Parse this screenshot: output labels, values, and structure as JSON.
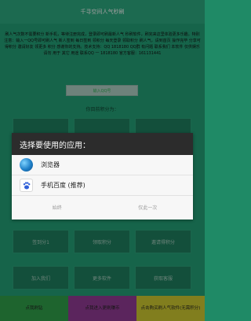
{
  "app": {
    "title": "千寻空间人气秒刷",
    "notice": "刷人气次数不需要积分 新手机，等待注册完成，登录即可刷最新人气 秒刷软件，刷完来这里体验更多乐趣。特别注意：输入一QQ号即可刷人气 新人签到 每日签到 领积分 每天登录 领取积分 刷人气，请到首页 操作完毕 分享可得积分 邀请好友 领更多 积分 感谢你的支持。技术支持：QQ 1818180 QQ群 有问题 联系我们 本软件 仅供娱乐 请勿 用于 其它 用途 联系QQ 一 1818180 官方客服：161131441",
    "input_placeholder": "输入QQ号",
    "points_label": "你目前积分为：",
    "grid_row1": [
      "",
      "",
      ""
    ],
    "grid_row2": [
      "签到分1",
      "领取积分",
      "邀请得积分"
    ],
    "grid_row3": [
      "加入我们",
      "更多软件",
      "获取客服"
    ],
    "bottom": [
      {
        "label": "点我刷钻",
        "color": "#2e9a47"
      },
      {
        "label": "点我进入更刷赚币",
        "color": "#8d3a8f"
      },
      {
        "label": "点击购买刷人气软件(无需积分)",
        "color": "#c7c22e"
      }
    ]
  },
  "dialog": {
    "title": "选择要使用的应用：",
    "apps": [
      {
        "label": "浏览器",
        "icon": "browser-icon"
      },
      {
        "label": "手机百度 (推荐)",
        "icon": "baidu-paw-icon"
      }
    ],
    "always_label": "始终",
    "once_label": "仅此一次"
  }
}
